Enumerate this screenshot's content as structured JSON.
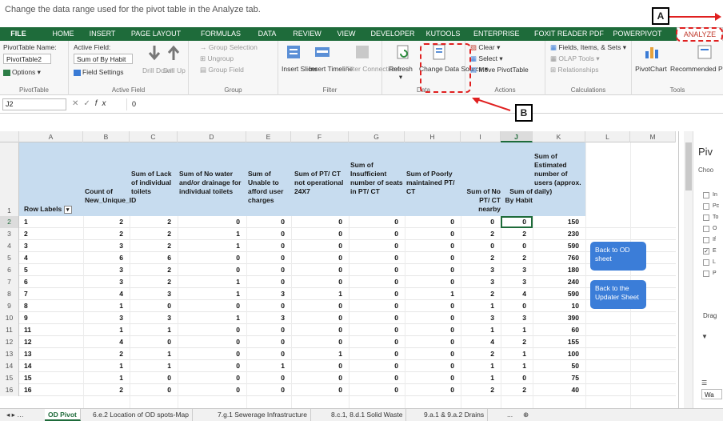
{
  "instruction": "Change the data range used for the pivot table in the Analyze tab.",
  "ribbon_tabs": [
    "FILE",
    "HOME",
    "INSERT",
    "PAGE LAYOUT",
    "FORMULAS",
    "DATA",
    "REVIEW",
    "VIEW",
    "DEVELOPER",
    "KUTOOLS",
    "ENTERPRISE",
    "FOXIT READER PDF",
    "POWERPIVOT",
    "ANALYZE"
  ],
  "ribbon": {
    "pivottable": {
      "name_label": "PivotTable Name:",
      "name_value": "PivotTable2",
      "options": "Options",
      "group": "PivotTable"
    },
    "active_field": {
      "label": "Active Field:",
      "value": "Sum of By Habit",
      "field_settings": "Field Settings",
      "drill_down": "Drill Down",
      "drill_up": "Drill Up",
      "group": "Active Field"
    },
    "group_grp": {
      "selection": "Group Selection",
      "ungroup": "Ungroup",
      "group_field": "Group Field",
      "group": "Group"
    },
    "filter": {
      "slicer": "Insert Slicer",
      "timeline": "Insert Timeline",
      "connections": "Filter Connections",
      "group": "Filter"
    },
    "data": {
      "refresh": "Refresh",
      "change_source": "Change Data Source",
      "group": "Data"
    },
    "actions": {
      "clear": "Clear",
      "select": "Select",
      "move": "Move PivotTable",
      "group": "Actions"
    },
    "calculations": {
      "fields": "Fields, Items, & Sets",
      "olap": "OLAP Tools",
      "relationships": "Relationships",
      "group": "Calculations"
    },
    "tools": {
      "pivotchart": "PivotChart",
      "recommended": "Recommended PivotTables",
      "group": "Tools"
    }
  },
  "formula_bar": {
    "cell_ref": "J2",
    "value": "0"
  },
  "columns": [
    "A",
    "B",
    "C",
    "D",
    "E",
    "F",
    "G",
    "H",
    "I",
    "J",
    "K",
    "L",
    "M"
  ],
  "headers": [
    "Row Labels",
    "Count of New_Unique_ID",
    "Sum of Lack of individual toilets",
    "Sum of No water and/or drainage for individual toilets",
    "Sum of Unable to afford user charges",
    "Sum of PT/ CT not operational 24X7",
    "Sum of Insufficient number of seats in PT/ CT",
    "Sum of Poorly maintained PT/ CT",
    "Sum of No PT/ CT nearby",
    "Sum of By Habit",
    "Sum of Estimated number of users (approx. daily)"
  ],
  "rows": [
    [
      "1",
      "2",
      "2",
      "0",
      "0",
      "0",
      "0",
      "0",
      "0",
      "0",
      "150"
    ],
    [
      "2",
      "2",
      "2",
      "1",
      "0",
      "0",
      "0",
      "0",
      "2",
      "2",
      "230"
    ],
    [
      "3",
      "3",
      "2",
      "1",
      "0",
      "0",
      "0",
      "0",
      "0",
      "0",
      "590"
    ],
    [
      "4",
      "6",
      "6",
      "0",
      "0",
      "0",
      "0",
      "0",
      "2",
      "2",
      "760"
    ],
    [
      "5",
      "3",
      "2",
      "0",
      "0",
      "0",
      "0",
      "0",
      "3",
      "3",
      "180"
    ],
    [
      "6",
      "3",
      "2",
      "1",
      "0",
      "0",
      "0",
      "0",
      "3",
      "3",
      "240"
    ],
    [
      "7",
      "4",
      "3",
      "1",
      "3",
      "1",
      "0",
      "1",
      "2",
      "4",
      "590"
    ],
    [
      "8",
      "1",
      "0",
      "0",
      "0",
      "0",
      "0",
      "0",
      "1",
      "0",
      "10"
    ],
    [
      "9",
      "3",
      "3",
      "1",
      "3",
      "0",
      "0",
      "0",
      "3",
      "3",
      "390"
    ],
    [
      "11",
      "1",
      "1",
      "0",
      "0",
      "0",
      "0",
      "0",
      "1",
      "1",
      "60"
    ],
    [
      "12",
      "4",
      "0",
      "0",
      "0",
      "0",
      "0",
      "0",
      "4",
      "2",
      "155"
    ],
    [
      "13",
      "2",
      "1",
      "0",
      "0",
      "1",
      "0",
      "0",
      "2",
      "1",
      "100"
    ],
    [
      "14",
      "1",
      "1",
      "0",
      "1",
      "0",
      "0",
      "0",
      "1",
      "1",
      "50"
    ],
    [
      "15",
      "1",
      "0",
      "0",
      "0",
      "0",
      "0",
      "0",
      "1",
      "0",
      "75"
    ],
    [
      "16",
      "2",
      "0",
      "0",
      "0",
      "0",
      "0",
      "0",
      "2",
      "2",
      "40"
    ]
  ],
  "row_numbers": [
    "1",
    "2",
    "3",
    "4",
    "5",
    "6",
    "7",
    "8",
    "9",
    "10",
    "11",
    "12",
    "13",
    "14",
    "15",
    "16"
  ],
  "buttons": {
    "back_od": "Back to OD sheet",
    "back_updater": "Back to the Updater Sheet"
  },
  "pane": {
    "title": "Piv",
    "choose": "Choo",
    "drag": "Drag",
    "items": [
      "In",
      "Pc",
      "To",
      "O",
      "If",
      "E",
      "L",
      "P"
    ],
    "wa": "Wa",
    "d": "D"
  },
  "sheet_tabs": [
    "OD Pivot",
    "6.e.2 Location of OD spots-Map",
    "7.g.1 Sewerage Infrastructure",
    "8.c.1, 8.d.1 Solid Waste",
    "9.a.1 & 9.a.2 Drains",
    "..."
  ],
  "callouts": {
    "a": "A",
    "b": "B"
  },
  "colors": {
    "ribbon_green": "#1e6b3a",
    "header_blue": "#c7dcef",
    "button_blue": "#3b7dd8",
    "annotation_red": "#e02020"
  }
}
